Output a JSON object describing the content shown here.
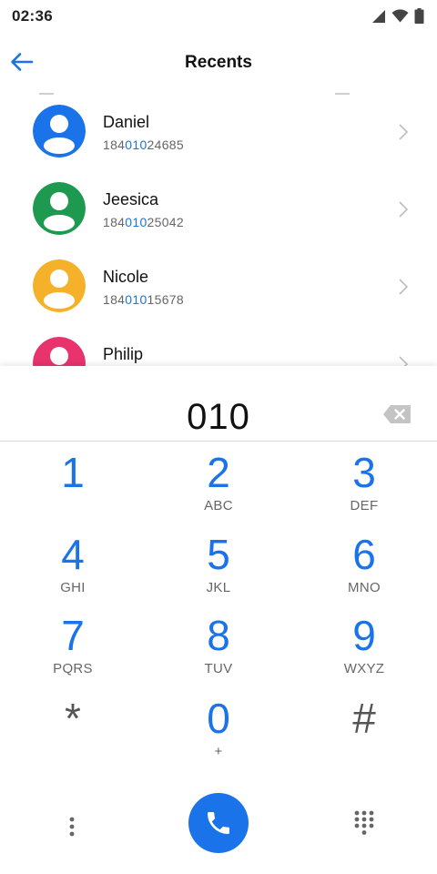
{
  "status_bar": {
    "time": "02:36",
    "icons": [
      "signal-icon",
      "wifi-icon",
      "battery-icon"
    ]
  },
  "app_bar": {
    "title": "Recents",
    "back_icon": "arrow-left-icon"
  },
  "contacts": [
    {
      "name": "Daniel",
      "number_prefix": "184",
      "number_match": "010",
      "number_suffix": "24685",
      "avatar_color": "#1a73e8"
    },
    {
      "name": "Jeesica",
      "number_prefix": "184",
      "number_match": "010",
      "number_suffix": "25042",
      "avatar_color": "#1e9a50"
    },
    {
      "name": "Nicole",
      "number_prefix": "184",
      "number_match": "010",
      "number_suffix": "15678",
      "avatar_color": "#f6b12b"
    },
    {
      "name": "Philip",
      "number_prefix": "",
      "number_match": "",
      "number_suffix": "",
      "avatar_color": "#e8336d"
    }
  ],
  "dialer": {
    "input_value": "010",
    "keys": [
      {
        "digit": "1",
        "letters": ""
      },
      {
        "digit": "2",
        "letters": "ABC"
      },
      {
        "digit": "3",
        "letters": "DEF"
      },
      {
        "digit": "4",
        "letters": "GHI"
      },
      {
        "digit": "5",
        "letters": "JKL"
      },
      {
        "digit": "6",
        "letters": "MNO"
      },
      {
        "digit": "7",
        "letters": "PQRS"
      },
      {
        "digit": "8",
        "letters": "TUV"
      },
      {
        "digit": "9",
        "letters": "WXYZ"
      },
      {
        "digit": "*",
        "letters": ""
      },
      {
        "digit": "0",
        "letters": "+"
      },
      {
        "digit": "#",
        "letters": ""
      }
    ]
  },
  "colors": {
    "accent": "#1a73e8",
    "text_secondary": "#666666"
  }
}
